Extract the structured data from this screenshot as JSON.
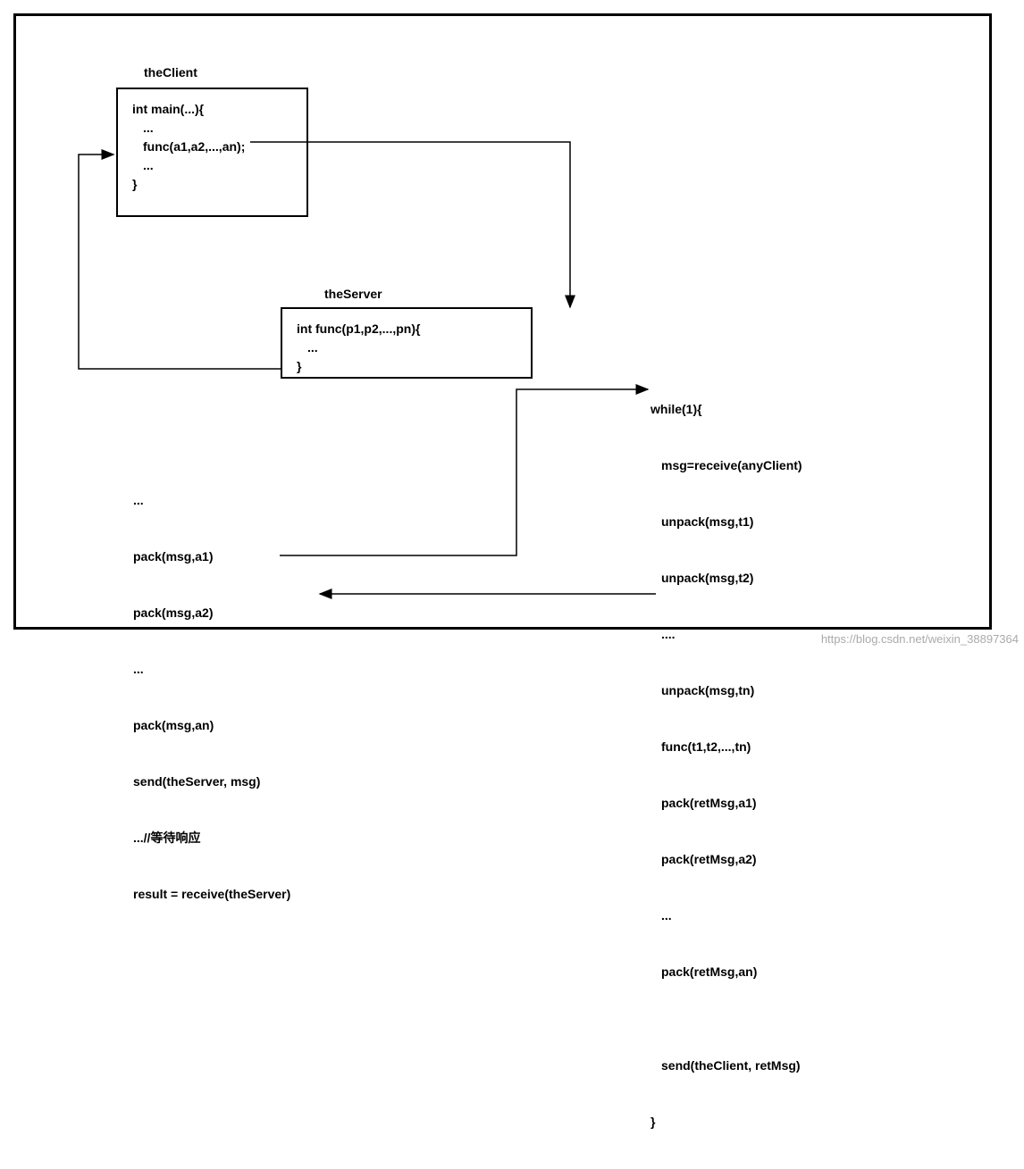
{
  "labels": {
    "clientTitle": "theClient",
    "serverTitle": "theServer"
  },
  "clientBox": {
    "l1": "int main(...){",
    "l2": "...",
    "l3": "func(a1,a2,...,an);",
    "l4": "...",
    "l5": "}"
  },
  "serverBox": {
    "l1": "int func(p1,p2,...,pn){",
    "l2": "...",
    "l3": "}"
  },
  "clientPack": {
    "l1": "...",
    "l2": "pack(msg,a1)",
    "l3": "pack(msg,a2)",
    "l4": "...",
    "l5": "pack(msg,an)",
    "l6": "send(theServer, msg)",
    "l7": "...//等待响应",
    "l8": "result = receive(theServer)"
  },
  "serverLoop": {
    "l1": "while(1){",
    "l2": "msg=receive(anyClient)",
    "l3": "unpack(msg,t1)",
    "l4": "unpack(msg,t2)",
    "l5": "....",
    "l6": "unpack(msg,tn)",
    "l7": "func(t1,t2,...,tn)",
    "l8": "pack(retMsg,a1)",
    "l9": "pack(retMsg,a2)",
    "l10": "...",
    "l11": "pack(retMsg,an)",
    "l12": "",
    "l13": "send(theClient, retMsg)",
    "l14": "}"
  },
  "watermark": "https://blog.csdn.net/weixin_38897364"
}
